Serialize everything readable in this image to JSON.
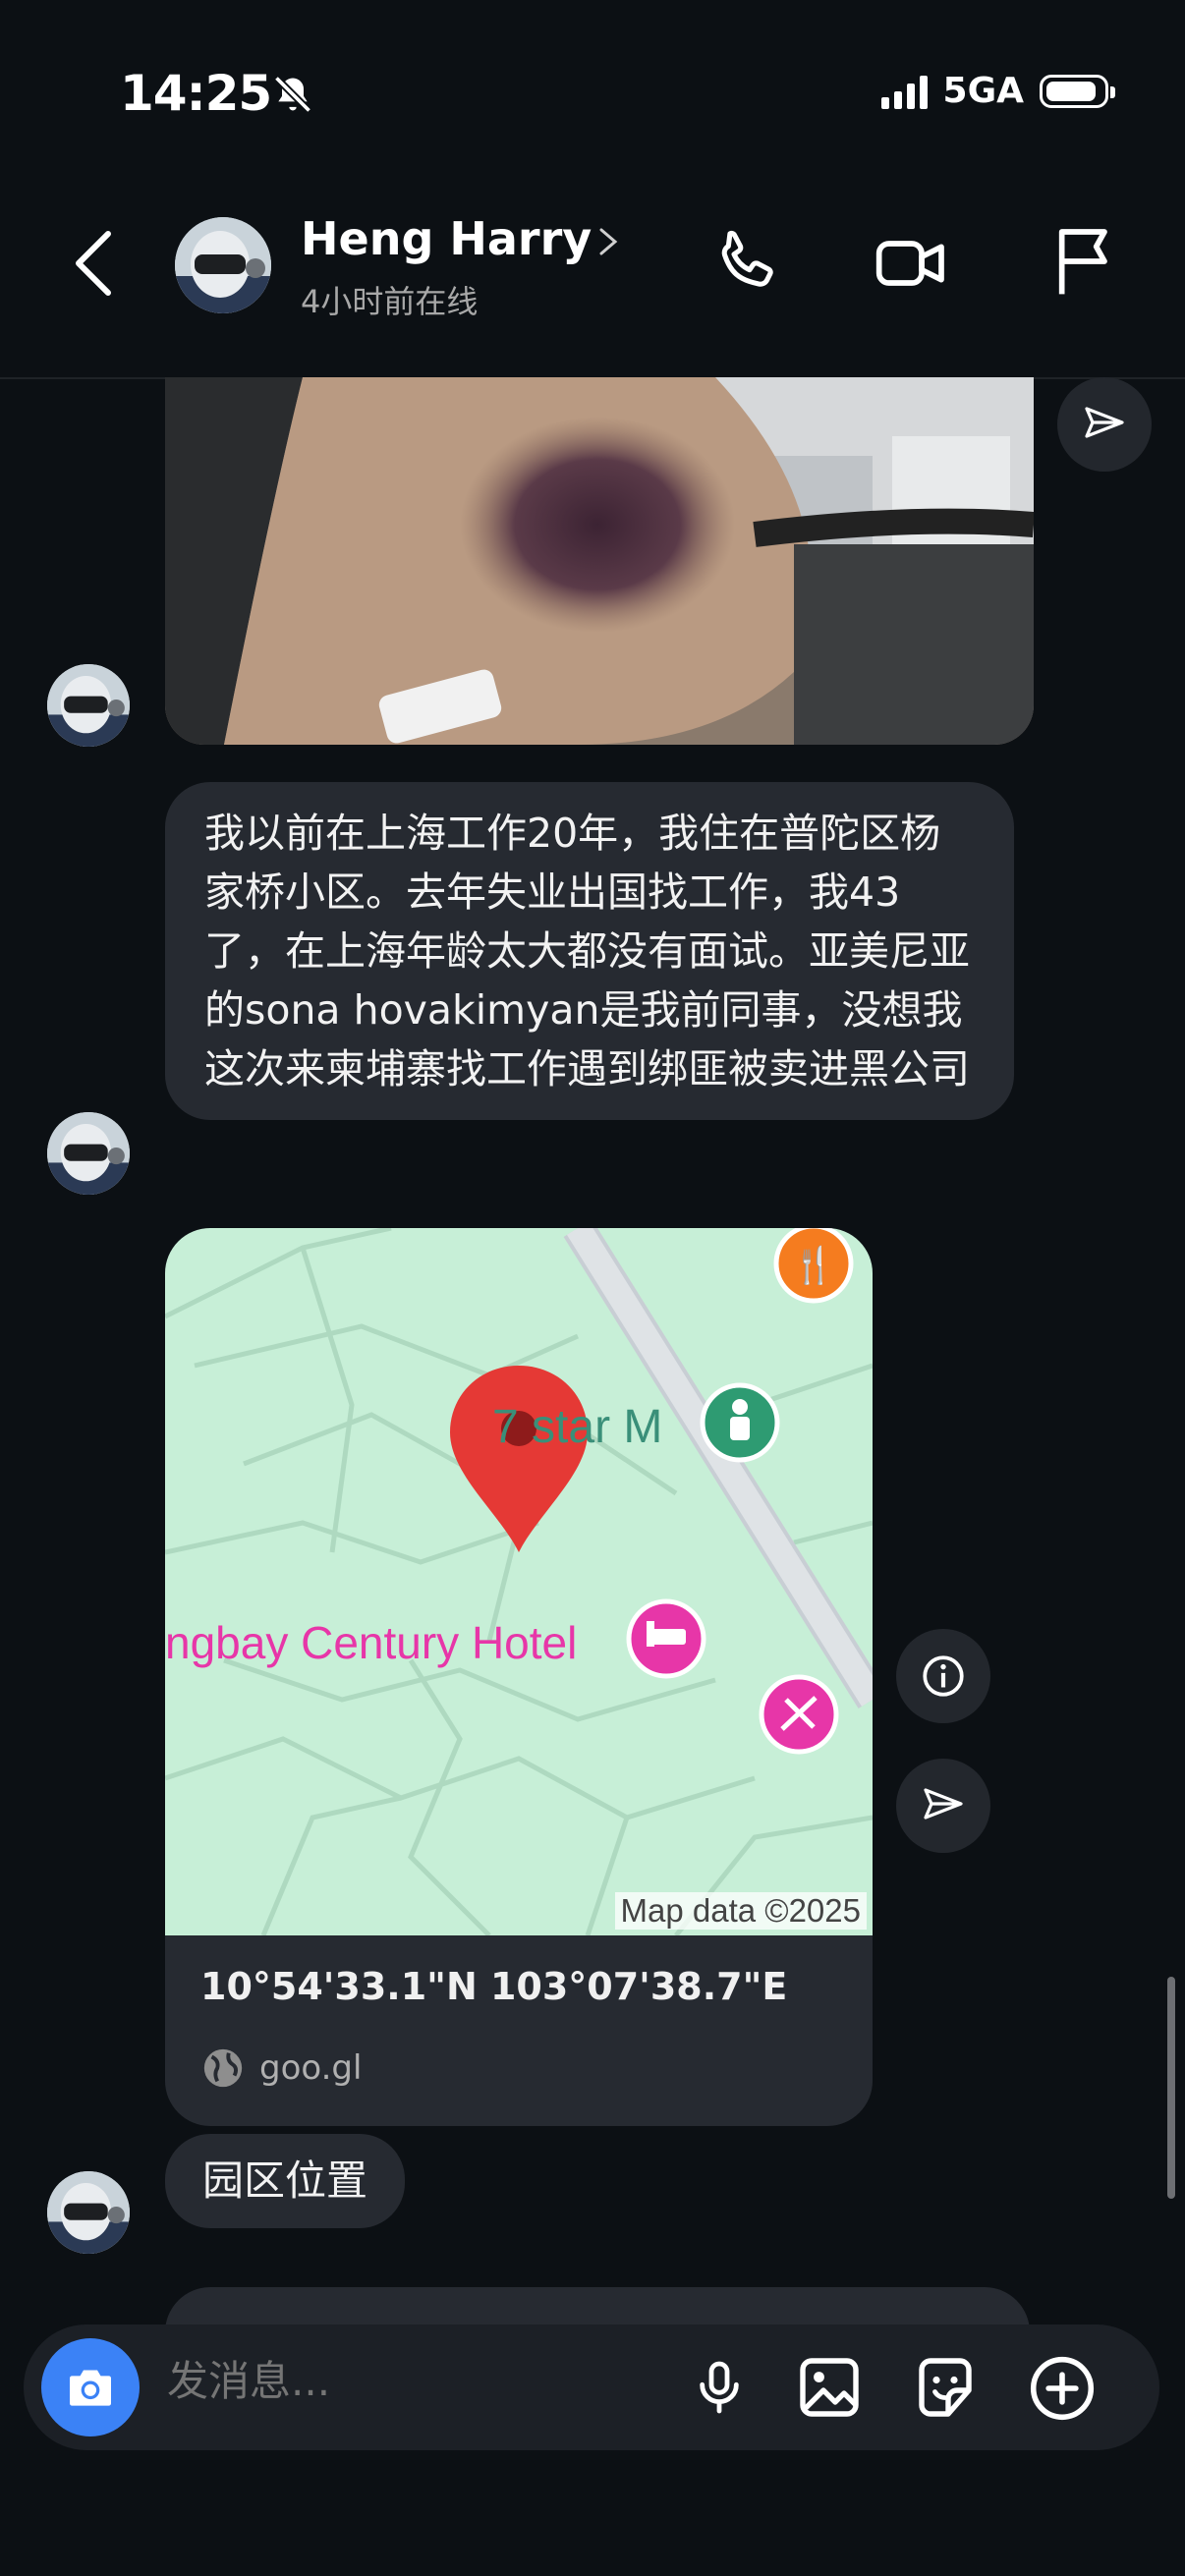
{
  "status_bar": {
    "time": "14:25",
    "network": "5GA",
    "battery_level": 0.9,
    "mute_icon": "bell-slash-icon"
  },
  "header": {
    "contact_name": "Heng Harry",
    "contact_status": "4小时前在线",
    "icons": [
      "back-icon",
      "chevron-right-icon",
      "phone-icon",
      "video-icon",
      "flag-icon"
    ]
  },
  "messages": {
    "text_1": "我以前在上海工作20年，我住在普陀区杨家桥小区。去年失业出国找工作，我43了，在上海年龄太大都没有面试。亚美尼亚的sona hovakimyan是我前同事，没想我这次来柬埔寨找工作遇到绑匪被卖进黑公司",
    "location_card": {
      "map_label_hotel": "ngbay Century Hotel",
      "map_label_star": "7 star M",
      "map_credit": "Map data ©2025",
      "coordinates": "10°54'33.1\"N 103°07'38.7\"E",
      "link": "goo.gl"
    },
    "text_2": "园区位置"
  },
  "composer": {
    "placeholder": "发消息..."
  },
  "colors": {
    "background": "#0c1014",
    "bubble": "#262a31",
    "accent": "#3b82f6",
    "map": "#c7efd7",
    "pin": "#e53935",
    "poi_pink": "#e736a8",
    "poi_green": "#2e9b72",
    "poi_orange": "#f57c1f"
  }
}
